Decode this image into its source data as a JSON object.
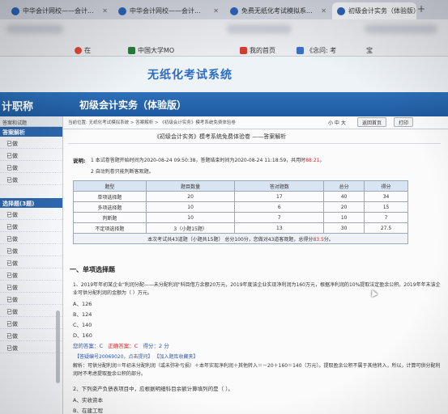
{
  "browser": {
    "tabs": [
      {
        "label": "中华会计网校——会计..."
      },
      {
        "label": "中华会计网校——会计..."
      },
      {
        "label": "免费无纸化考试模拟系..."
      },
      {
        "label": "初级会计实务（体验版）"
      }
    ],
    "bookmarks": {
      "b1": "在",
      "b2": "中国大学MO",
      "b3": "我的首页",
      "b4": "《念问: 考",
      "b5": "宝"
    }
  },
  "site": {
    "title": "无纸化考试系统",
    "nav_left": "计职称",
    "nav_center": "初级会计实务（体验版）"
  },
  "sidebar": {
    "header": "答案和试题",
    "section1": "答案解析",
    "section2": "选择题(3题)",
    "items_top": [
      "已做",
      "已做",
      "已做",
      "已做"
    ],
    "items_bottom": [
      "已做",
      "已做",
      "已做",
      "已做",
      "已做",
      "已做",
      "已做",
      "已做",
      "已做",
      "已做",
      "已做",
      "已做"
    ]
  },
  "main": {
    "breadcrumb": "当前位置: 无纸化考试模拟系统 > 答案解析 > 《初级会计实务》模考系统免费体验卷",
    "font_sizes": "小  中  大",
    "btn_home": "返回首页",
    "btn_print": "打印",
    "page_heading": "《初级会计实务》模考系统免费体验卷 ——答案解析",
    "instr_label": "说明:",
    "instr1_pre": "1 本试卷答题开始时间为2020-08-24 09:50:38，答题结束时间为2020-08-24 11:18:59，共用时",
    "instr1_time": "88:21",
    "instr1_post": "。",
    "instr2": "2 自动判卷只能判断客观题。",
    "table": {
      "headers": [
        "题型",
        "题目数量",
        "答对题数",
        "总分",
        "得分"
      ],
      "rows": [
        [
          "单项选择题",
          "20",
          "17",
          "40",
          "34"
        ],
        [
          "多项选择题",
          "10",
          "6",
          "20",
          "15"
        ],
        [
          "判断题",
          "10",
          "7",
          "10",
          "7"
        ],
        [
          "不定项选择题",
          "3（小题15题）",
          "13",
          "30",
          "27.5"
        ]
      ],
      "summary_pre": "本次考试共43道题（小题共15题）  总分100分，您做对43道客观题，总得分",
      "summary_score": "83.5",
      "summary_post": "分。"
    },
    "section_title": "一、单项选择题",
    "q1_text": "1、2019年年初某企业\"利润分配——未分配利润\"科目借方余额20万元，2019年度该企业实现净利润为160万元，根据净利润的10%提取法定盈余公积。2019年年末该企业可供分配利润的金额为（   ）万元。",
    "q1_options": [
      "A、126",
      "B、124",
      "C、140",
      "D、160"
    ],
    "your_answer_label": "您的答案：C",
    "correct_answer_label": "正确答案：C",
    "score_label": "得分：2 分",
    "links": "【答疑编号20069020，点击提问】 【加入题库收藏夹】",
    "analysis": "解析：可供分配利润＝年初未分配利润（或未弥补亏损）＋本年实现净利润＋其他转入＝－20＋160＝140（万元）。提取盈余公积不属于其他转入，所以，计算可供分配利润时不考虑提取盈余公积的部分。",
    "q2_text": "2、下列资产负债表项目中，应根据明细科目余额计算填列的是（   ）。",
    "q2_options": [
      "A、实收资本",
      "B、在建工程"
    ]
  }
}
